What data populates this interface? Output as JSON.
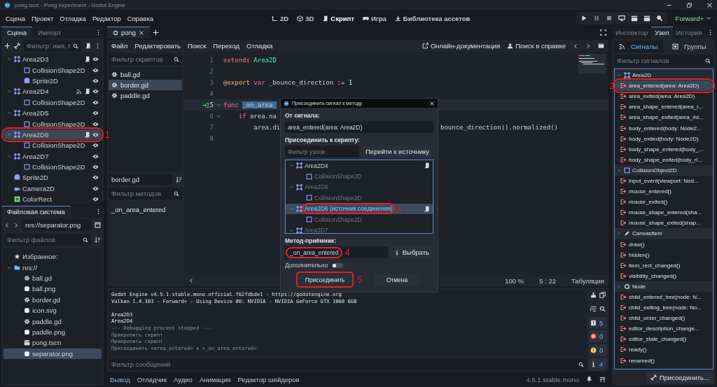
{
  "window": {
    "title": "pong.tscn - Pong experiment - Godot Engine"
  },
  "menu": [
    "Сцена",
    "Проект",
    "Отладка",
    "Редактор",
    "Справка"
  ],
  "workspaces": [
    {
      "label": "2D",
      "selected": false
    },
    {
      "label": "3D",
      "selected": false
    },
    {
      "label": "Скрипт",
      "selected": true
    },
    {
      "label": "Игра",
      "selected": false
    },
    {
      "label": "Библиотека ассетов",
      "selected": false
    }
  ],
  "renderer": "Forward+",
  "scene_dock": {
    "tabs": [
      {
        "label": "Сцена",
        "selected": true
      },
      {
        "label": "Импорт",
        "selected": false
      }
    ],
    "filter": {
      "placeholder": "Фильтр: имя, t"
    },
    "nodes": [
      {
        "name": "Area2D3",
        "kind": "area",
        "script": true,
        "signals": false,
        "selected": false,
        "expanded": true,
        "children": [
          {
            "name": "CollisionShape2D",
            "kind": "collision",
            "script": false,
            "signals": false,
            "selected": false
          },
          {
            "name": "Sprite2D",
            "kind": "sprite",
            "script": false,
            "signals": false,
            "selected": false
          }
        ]
      },
      {
        "name": "Area2D4",
        "kind": "area",
        "script": true,
        "signals": true,
        "selected": false,
        "expanded": true,
        "children": [
          {
            "name": "CollisionShape2D",
            "kind": "collision",
            "script": false,
            "signals": false,
            "selected": false
          }
        ]
      },
      {
        "name": "Area2D5",
        "kind": "area",
        "script": false,
        "signals": false,
        "selected": false,
        "expanded": true,
        "children": [
          {
            "name": "CollisionShape2D",
            "kind": "collision",
            "script": false,
            "signals": false,
            "selected": false
          }
        ]
      },
      {
        "name": "Area2D6",
        "kind": "area",
        "script": true,
        "signals": false,
        "selected": true,
        "annotation": "1",
        "expanded": true,
        "children": [
          {
            "name": "CollisionShape2D",
            "kind": "collision",
            "script": false,
            "signals": false,
            "selected": false
          }
        ]
      },
      {
        "name": "Area2D7",
        "kind": "area",
        "script": false,
        "signals": false,
        "selected": false,
        "expanded": true,
        "children": [
          {
            "name": "CollisionShape2D",
            "kind": "collision",
            "script": false,
            "signals": false,
            "selected": false
          }
        ]
      },
      {
        "name": "Sprite2D",
        "kind": "sprite",
        "script": false,
        "signals": false,
        "selected": false
      },
      {
        "name": "Camera2D",
        "kind": "camera",
        "script": false,
        "signals": false,
        "selected": false
      },
      {
        "name": "ColorRect",
        "kind": "colorrect",
        "script": false,
        "signals": false,
        "selected": false
      }
    ]
  },
  "filesystem": {
    "tab": "Файловая система",
    "path": "res://separator.png",
    "filter": {
      "placeholder": "Фильтр файлов"
    },
    "items": [
      {
        "name": "Избранное:",
        "kind": "favorites",
        "selected": false
      },
      {
        "name": "res://",
        "kind": "folder",
        "selected": false,
        "expanded": true,
        "children": [
          {
            "name": "ball.gd",
            "kind": "script",
            "selected": false
          },
          {
            "name": "ball.png",
            "kind": "image",
            "selected": false
          },
          {
            "name": "border.gd",
            "kind": "script",
            "selected": false
          },
          {
            "name": "icon.svg",
            "kind": "image",
            "selected": false
          },
          {
            "name": "paddle.gd",
            "kind": "script",
            "selected": false
          },
          {
            "name": "paddle.png",
            "kind": "image",
            "selected": false
          },
          {
            "name": "pong.tscn",
            "kind": "scene",
            "selected": false
          },
          {
            "name": "separator.png",
            "kind": "image",
            "selected": true
          }
        ]
      }
    ]
  },
  "editor": {
    "tabs": [
      {
        "label": "pong",
        "selected": true
      }
    ],
    "menu": [
      "Файл",
      "Редактировать",
      "Поиск",
      "Переход",
      "Отладка"
    ],
    "links": [
      "Онлайн-документация",
      "Поиск в справке"
    ],
    "script_filter": {
      "placeholder": "Фильтр скриптов"
    },
    "scripts": [
      {
        "name": "ball.gd",
        "selected": false
      },
      {
        "name": "border.gd",
        "selected": true
      },
      {
        "name": "paddle.gd",
        "selected": false
      }
    ],
    "current_script": "border.gd",
    "method_filter": {
      "placeholder": "Фильтр методов"
    },
    "methods": [
      "_on_area_entered"
    ],
    "lines": [
      {
        "number": "1",
        "current": false,
        "connected": false,
        "fold": false,
        "tokens": [
          {
            "text": "extends",
            "kind": "keyword"
          },
          {
            "text": "Area2D",
            "kind": "type"
          }
        ]
      },
      {
        "number": "2",
        "current": false,
        "connected": false,
        "fold": false
      },
      {
        "number": "3",
        "current": false,
        "connected": false,
        "fold": false,
        "tokens": [
          {
            "text": "@export",
            "kind": "annotation"
          },
          {
            "text": "var",
            "kind": "keyword"
          },
          {
            "text": "_bounce_direction :=",
            "kind": "plain"
          },
          {
            "text": "1",
            "kind": "number"
          }
        ]
      },
      {
        "number": "4",
        "current": false,
        "connected": false,
        "fold": false
      },
      {
        "number": "5",
        "current": true,
        "connected": true,
        "fold": true,
        "tokens": [
          {
            "text": "func",
            "kind": "keyword"
          },
          {
            "text": "_on_area_",
            "kind": "selected"
          }
        ]
      },
      {
        "number": "6",
        "current": false,
        "connected": false,
        "fold": true,
        "tokens": [
          {
            "text": "\tif",
            "kind": "keyword"
          },
          {
            "text": "area.na",
            "kind": "plain"
          }
        ]
      },
      {
        "number": "7",
        "current": false,
        "connected": false,
        "fold": false,
        "tokens": [
          {
            "text": "\t\tarea.di",
            "kind": "plain"
          }
        ],
        "tail": "bounce_direction)).normalized()"
      },
      {
        "number": "8",
        "current": false,
        "connected": false,
        "fold": false
      }
    ],
    "status": {
      "zoom": "100 %",
      "position": "5 : 22",
      "indent": "Табуляция"
    }
  },
  "dialog": {
    "title": "Присоединить сигнал к методу",
    "signal_label": "От сигнала:",
    "signal": "area_entered(area: Area2D)",
    "script_label": "Присоединить к скрипту:",
    "node_filter": {
      "placeholder": "Фильтр узлов"
    },
    "goto_button": "Перейти к источнику",
    "nodes": [
      {
        "name": "Area2D4",
        "kind": "area",
        "script": true,
        "dimmed": false,
        "selected": false,
        "expanded": true,
        "children": [
          {
            "name": "CollisionShape2D",
            "kind": "collision",
            "script": false,
            "dimmed": true,
            "selected": false
          }
        ]
      },
      {
        "name": "Area2D5",
        "kind": "area",
        "script": false,
        "dimmed": true,
        "selected": false,
        "expanded": true,
        "children": [
          {
            "name": "CollisionShape2D",
            "kind": "collision",
            "script": false,
            "dimmed": true,
            "selected": false
          }
        ]
      },
      {
        "name": "Area2D6 (источник соединения)",
        "kind": "area",
        "script": true,
        "dimmed": false,
        "selected": true,
        "annotation": "3",
        "expanded": true,
        "children": [
          {
            "name": "CollisionShape2D",
            "kind": "collision",
            "script": false,
            "dimmed": true,
            "selected": false
          }
        ]
      },
      {
        "name": "Area2D7",
        "kind": "area",
        "script": false,
        "dimmed": true,
        "selected": false,
        "expanded": true
      }
    ],
    "method_label": "Метод-приёмник:",
    "method": {
      "value": "_on_area_entered",
      "annotation": "4"
    },
    "pick_button": "Выбрать",
    "advanced": {
      "label": "Дополнительно",
      "on": false
    },
    "connect_button": {
      "label": "Присоединить",
      "annotation": "5"
    },
    "cancel_button": "Отмена"
  },
  "signals_dock": {
    "tabs": [
      {
        "label": "Инспектор",
        "selected": false
      },
      {
        "label": "Узел",
        "selected": true
      },
      {
        "label": "История",
        "selected": false
      }
    ],
    "subtabs": [
      {
        "label": "Сигналы",
        "selected": true
      },
      {
        "label": "Группы",
        "selected": false
      }
    ],
    "filter": {
      "placeholder": "Фильтр сигналов"
    },
    "groups": [
      {
        "name": "Area2D",
        "kind": "area",
        "expanded": true,
        "children": [
          {
            "name": "area_entered(area: Area2D)",
            "selected": true,
            "annotation": "2"
          },
          {
            "name": "area_exited(area: Area2D)",
            "selected": false
          },
          {
            "name": "area_shape_entered(area_r...",
            "selected": false
          },
          {
            "name": "area_shape_exited(area_rid...",
            "selected": false
          },
          {
            "name": "body_entered(body: Node2...",
            "selected": false
          },
          {
            "name": "body_exited(body: Node2D)",
            "selected": false
          },
          {
            "name": "body_shape_entered(body_...",
            "selected": false
          },
          {
            "name": "body_shape_exited(body_ri...",
            "selected": false
          }
        ]
      },
      {
        "name": "CollisionObject2D",
        "kind": "collision",
        "expanded": true,
        "children": [
          {
            "name": "input_event(viewport: Nod...",
            "selected": false
          },
          {
            "name": "mouse_entered()",
            "selected": false
          },
          {
            "name": "mouse_exited()",
            "selected": false
          },
          {
            "name": "mouse_shape_entered(sha...",
            "selected": false
          },
          {
            "name": "mouse_shape_exited(shap...",
            "selected": false
          }
        ]
      },
      {
        "name": "CanvasItem",
        "kind": "canvas",
        "expanded": true,
        "children": [
          {
            "name": "draw()",
            "selected": false
          },
          {
            "name": "hidden()",
            "selected": false
          },
          {
            "name": "item_rect_changed()",
            "selected": false
          },
          {
            "name": "visibility_changed()",
            "selected": false
          }
        ]
      },
      {
        "name": "Node",
        "kind": "node",
        "expanded": true,
        "children": [
          {
            "name": "child_entered_tree(node: N...",
            "selected": false
          },
          {
            "name": "child_exiting_tree(node: No...",
            "selected": false
          },
          {
            "name": "child_order_changed()",
            "selected": false
          },
          {
            "name": "editor_description_change...",
            "selected": false
          },
          {
            "name": "editor_state_changed()",
            "selected": false
          },
          {
            "name": "ready()",
            "selected": false
          },
          {
            "name": "renamed()",
            "selected": false
          }
        ]
      }
    ],
    "connect_button": "Присоединить..."
  },
  "output": {
    "lines": [
      {
        "text": "Godot Engine v4.5.1.stable.mono.official.f62fdbde1 - https://godotengine.org",
        "kind": "normal",
        "spaced": false
      },
      {
        "text": "Vulkan 1.4.303 - Forward+ - Using Device #0: NVIDIA - NVIDIA GeForce GTX 1060 6GB",
        "kind": "normal",
        "spaced": false
      },
      {
        "text": "Area2D3",
        "kind": "normal",
        "spaced": true
      },
      {
        "text": "Area2D4",
        "kind": "normal",
        "spaced": false
      },
      {
        "text": "--- Debugging process stopped ---",
        "kind": "dim",
        "spaced": false
      },
      {
        "text": "Прикрепить скрипт",
        "kind": "dim",
        "spaced": false
      },
      {
        "text": "Прикрепить скрипт",
        "kind": "dim",
        "spaced": false
      },
      {
        "text": "Присоединить «area_entered» к «_on_area_entered»",
        "kind": "dim",
        "spaced": false
      }
    ],
    "filter": {
      "placeholder": "Фильтр сообщений"
    },
    "counters": [
      {
        "count": "5",
        "kind": "log"
      },
      {
        "count": "0",
        "kind": "error"
      },
      {
        "count": "0",
        "kind": "warning"
      },
      {
        "count": "4",
        "kind": "info"
      }
    ]
  },
  "bottom_tabs": [
    {
      "label": "Вывод",
      "selected": true
    },
    {
      "label": "Отладчик",
      "selected": false
    },
    {
      "label": "Аудио",
      "selected": false
    },
    {
      "label": "Анимация",
      "selected": false
    },
    {
      "label": "Редактор шейдеров",
      "selected": false
    }
  ],
  "version": "4.5.1.stable.mono"
}
